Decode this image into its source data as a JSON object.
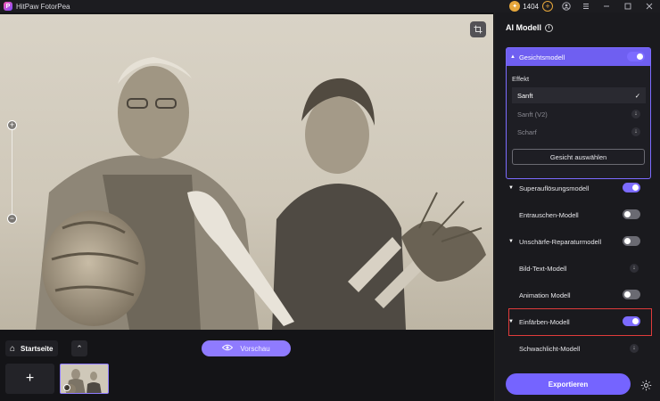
{
  "titlebar": {
    "app_name": "HitPaw FotorPea",
    "coins": "1404",
    "add_coin_glyph": "+",
    "icons": [
      "ai-badge-icon",
      "account-icon",
      "menu-icon",
      "minimize-icon",
      "maximize-icon",
      "close-icon"
    ]
  },
  "canvas": {
    "zoom_in": "+",
    "zoom_out": "−"
  },
  "bottombar": {
    "home_label": "Startseite",
    "preview_label": "Vorschau",
    "add_glyph": "+"
  },
  "panel": {
    "title": "AI Modell",
    "face_model": {
      "label": "Gesichtsmodell",
      "enabled": true,
      "effect_label": "Effekt",
      "options": [
        {
          "label": "Sanft",
          "selected": true
        },
        {
          "label": "Sanft (V2)",
          "selected": false
        },
        {
          "label": "Scharf",
          "selected": false
        }
      ],
      "select_face_label": "Gesicht auswählen"
    },
    "models": [
      {
        "label": "Superauflösungsmodell",
        "expandable": true,
        "control": "toggle",
        "enabled": true
      },
      {
        "label": "Entrauschen-Modell",
        "expandable": false,
        "control": "toggle",
        "enabled": false
      },
      {
        "label": "Unschärfe-Reparaturmodell",
        "expandable": true,
        "control": "toggle",
        "enabled": false
      },
      {
        "label": "Bild-Text-Modell",
        "expandable": false,
        "control": "download",
        "enabled": false
      },
      {
        "label": "Animation Modell",
        "expandable": false,
        "control": "toggle",
        "enabled": false
      },
      {
        "label": "Einfärben-Modell",
        "expandable": true,
        "control": "toggle",
        "enabled": true
      },
      {
        "label": "Schwachlicht-Modell",
        "expandable": false,
        "control": "download",
        "enabled": false
      }
    ],
    "export_label": "Exportieren"
  },
  "colors": {
    "accent": "#7c6bff",
    "highlight": "#e03b3b",
    "coin": "#e7a73b"
  }
}
